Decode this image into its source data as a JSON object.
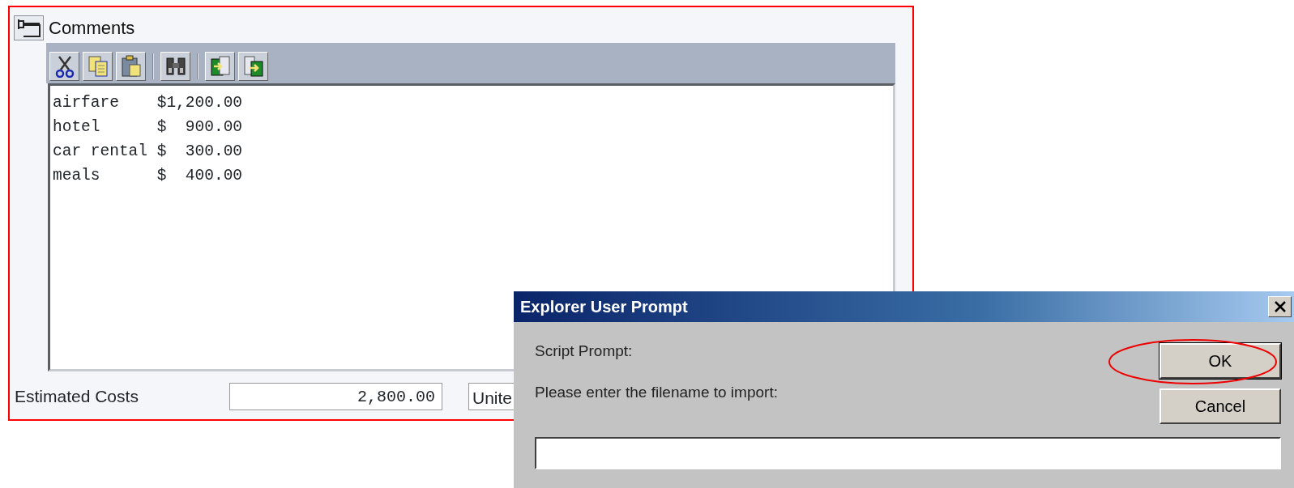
{
  "panel": {
    "title": "Comments",
    "toolbar": [
      {
        "kind": "cut"
      },
      {
        "kind": "copy"
      },
      {
        "kind": "paste"
      },
      {
        "kind": "separator"
      },
      {
        "kind": "find"
      },
      {
        "kind": "separator"
      },
      {
        "kind": "import"
      },
      {
        "kind": "export"
      }
    ],
    "comment_lines": [
      "airfare    $1,200.00",
      "hotel      $  900.00",
      "car rental $  300.00",
      "meals      $  400.00"
    ],
    "estimated_costs": {
      "label": "Estimated Costs",
      "value": "2,800.00",
      "currency": "Unite"
    }
  },
  "dialog": {
    "title": "Explorer User Prompt",
    "caption": "Script Prompt:",
    "message": "Please enter the filename to import:",
    "buttons": [
      {
        "label": "OK",
        "highlighted": true
      },
      {
        "label": "Cancel",
        "highlighted": false
      }
    ]
  }
}
